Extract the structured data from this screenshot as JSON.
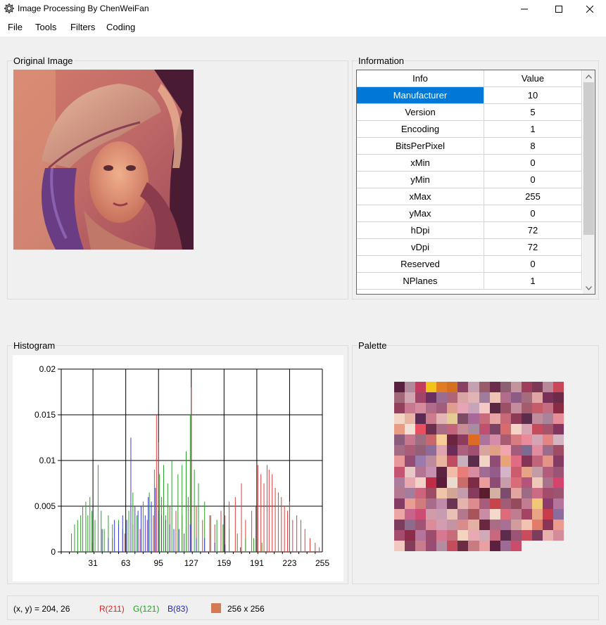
{
  "window": {
    "title": "Image Processing  By ChenWeiFan",
    "icons": {
      "app": "gear-icon",
      "minimize": "minimize-icon",
      "maximize": "maximize-icon",
      "close": "close-icon"
    }
  },
  "menu": [
    "File",
    "Tools",
    "Filters",
    "Coding"
  ],
  "original_image": {
    "group_title": "Original Image",
    "description_icon": "portrait-photo"
  },
  "information": {
    "group_title": "Information",
    "columns": [
      "Info",
      "Value"
    ],
    "rows": [
      [
        "Manufacturer",
        "10"
      ],
      [
        "Version",
        "5"
      ],
      [
        "Encoding",
        "1"
      ],
      [
        "BitsPerPixel",
        "8"
      ],
      [
        "xMin",
        "0"
      ],
      [
        "yMin",
        "0"
      ],
      [
        "xMax",
        "255"
      ],
      [
        "yMax",
        "0"
      ],
      [
        "hDpi",
        "72"
      ],
      [
        "vDpi",
        "72"
      ],
      [
        "Reserved",
        "0"
      ],
      [
        "NPlanes",
        "1"
      ]
    ],
    "selected_row": 0
  },
  "histogram": {
    "group_title": "Histogram"
  },
  "chart_data": {
    "type": "bar",
    "xlim": [
      0,
      255
    ],
    "ylim": [
      0,
      0.02
    ],
    "xticks": [
      31,
      63,
      95,
      127,
      159,
      191,
      223,
      255
    ],
    "yticks": [
      "0",
      "0.005",
      "0.01",
      "0.015",
      "0.02"
    ],
    "ytick_values": [
      0,
      0.005,
      0.01,
      0.015,
      0.02
    ],
    "grid": true,
    "series": [
      {
        "color": "#e03c3c",
        "bars": [
          [
            30,
            0.001
          ],
          [
            50,
            0.0015
          ],
          [
            62,
            0.002
          ],
          [
            70,
            0.003
          ],
          [
            77,
            0.0025
          ],
          [
            84,
            0.0035
          ],
          [
            90,
            0.004
          ],
          [
            93,
            0.015
          ],
          [
            95,
            0.012
          ],
          [
            98,
            0.006
          ],
          [
            102,
            0.004
          ],
          [
            106,
            0.005
          ],
          [
            112,
            0.0045
          ],
          [
            118,
            0.004
          ],
          [
            124,
            0.006
          ],
          [
            127,
            0.018
          ],
          [
            132,
            0.005
          ],
          [
            138,
            0.0035
          ],
          [
            145,
            0.004
          ],
          [
            150,
            0.003
          ],
          [
            156,
            0.0045
          ],
          [
            160,
            0.004
          ],
          [
            164,
            0.0055
          ],
          [
            170,
            0.006
          ],
          [
            176,
            0.0075
          ],
          [
            180,
            0.0035
          ],
          [
            186,
            0.0045
          ],
          [
            190,
            0.005
          ],
          [
            192,
            0.0095
          ],
          [
            195,
            0.0085
          ],
          [
            198,
            0.0075
          ],
          [
            201,
            0.0095
          ],
          [
            203,
            0.009
          ],
          [
            206,
            0.0085
          ],
          [
            209,
            0.007
          ],
          [
            212,
            0.0065
          ],
          [
            215,
            0.006
          ],
          [
            218,
            0.005
          ],
          [
            221,
            0.0045
          ],
          [
            223,
            0.0055
          ],
          [
            226,
            0.0035
          ],
          [
            230,
            0.004
          ],
          [
            234,
            0.0035
          ],
          [
            238,
            0.0025
          ],
          [
            243,
            0.0015
          ],
          [
            248,
            0.001
          ],
          [
            252,
            0.0005
          ]
        ]
      },
      {
        "color": "#2ca02c",
        "bars": [
          [
            10,
            0.002
          ],
          [
            13,
            0.003
          ],
          [
            16,
            0.0035
          ],
          [
            19,
            0.004
          ],
          [
            21,
            0.005
          ],
          [
            24,
            0.0055
          ],
          [
            26,
            0.004
          ],
          [
            28,
            0.006
          ],
          [
            30,
            0.0045
          ],
          [
            33,
            0.0035
          ],
          [
            36,
            0.0095
          ],
          [
            39,
            0.0045
          ],
          [
            42,
            0.0025
          ],
          [
            46,
            0.004
          ],
          [
            50,
            0.003
          ],
          [
            56,
            0.0035
          ],
          [
            60,
            0.0025
          ],
          [
            66,
            0.0045
          ],
          [
            70,
            0.0065
          ],
          [
            74,
            0.004
          ],
          [
            80,
            0.0055
          ],
          [
            86,
            0.0065
          ],
          [
            91,
            0.009
          ],
          [
            96,
            0.0085
          ],
          [
            100,
            0.0095
          ],
          [
            104,
            0.0075
          ],
          [
            108,
            0.01
          ],
          [
            114,
            0.0085
          ],
          [
            118,
            0.0095
          ],
          [
            122,
            0.011
          ],
          [
            126,
            0.015
          ],
          [
            130,
            0.009
          ],
          [
            134,
            0.0075
          ],
          [
            140,
            0.0055
          ],
          [
            146,
            0.004
          ],
          [
            152,
            0.0035
          ],
          [
            158,
            0.003
          ],
          [
            164,
            0.0025
          ],
          [
            172,
            0.002
          ],
          [
            180,
            0.0015
          ],
          [
            188,
            0.0015
          ],
          [
            196,
            0.001
          ]
        ]
      },
      {
        "color": "#3b3bd4",
        "bars": [
          [
            40,
            0.0025
          ],
          [
            46,
            0.0015
          ],
          [
            52,
            0.0035
          ],
          [
            56,
            0.003
          ],
          [
            60,
            0.004
          ],
          [
            64,
            0.0035
          ],
          [
            68,
            0.0125
          ],
          [
            72,
            0.005
          ],
          [
            75,
            0.0045
          ],
          [
            78,
            0.005
          ],
          [
            82,
            0.004
          ],
          [
            85,
            0.006
          ],
          [
            88,
            0.0055
          ],
          [
            92,
            0.007
          ],
          [
            95,
            0.0045
          ],
          [
            98,
            0.004
          ],
          [
            102,
            0.0035
          ],
          [
            106,
            0.003
          ],
          [
            110,
            0.0025
          ],
          [
            115,
            0.0025
          ],
          [
            120,
            0.002
          ],
          [
            126,
            0.003
          ],
          [
            132,
            0.0015
          ],
          [
            140,
            0.0015
          ],
          [
            150,
            0.001
          ],
          [
            160,
            0.0008
          ],
          [
            175,
            0.0005
          ]
        ]
      }
    ]
  },
  "palette": {
    "group_title": "Palette",
    "colors": [
      "#5a2040",
      "#b08a9a",
      "#c43c5c",
      "#f2c418",
      "#e07c24",
      "#d47020",
      "#8a4060",
      "#c4a0b0",
      "#9a5a6a",
      "#6c2c4c",
      "#8c6070",
      "#c4949c",
      "#a03c5c",
      "#7c3854",
      "#b88898",
      "#c84858",
      "#a06878",
      "#d0a4b0",
      "#a04468",
      "#6c3060",
      "#9a6c90",
      "#b06478",
      "#d8a4a4",
      "#e0b4b4",
      "#a07c9c",
      "#f0c4b4",
      "#b46c8c",
      "#8c5c84",
      "#a46c7c",
      "#e0a4a4",
      "#7a3058",
      "#6c2c48",
      "#94405c",
      "#c87890",
      "#d48c9c",
      "#b06c88",
      "#a25c7c",
      "#e09c8c",
      "#e8a4b4",
      "#c8a4b8",
      "#f4c8c4",
      "#5a2844",
      "#9c5068",
      "#c48c9c",
      "#a45c6c",
      "#c45c6c",
      "#c46c80",
      "#8c2c44",
      "#f4d4c4",
      "#e8b4a4",
      "#5a2c54",
      "#cc7c8c",
      "#e4b4b4",
      "#e4cc94",
      "#7c4c64",
      "#a86898",
      "#c86c7c",
      "#e8a4a4",
      "#c86878",
      "#8c3c54",
      "#5c2c4c",
      "#c08c9c",
      "#a8849c",
      "#e88c98",
      "#e89c84",
      "#f2e0d4",
      "#e85060",
      "#6a3050",
      "#a86c84",
      "#c4647c",
      "#c88c94",
      "#a88ca0",
      "#c05070",
      "#7c4464",
      "#d86c6c",
      "#f4d4c8",
      "#d8a4b4",
      "#c44c5c",
      "#a4546c",
      "#843460",
      "#8c5c7c",
      "#c8788c",
      "#a06c80",
      "#c8686c",
      "#f8cc98",
      "#6c2440",
      "#8c3c5c",
      "#dc6c24",
      "#ac7498",
      "#d48ca8",
      "#a85c70",
      "#d87c84",
      "#e88c9c",
      "#d4a4b4",
      "#e48484",
      "#d4b4c0",
      "#a46c84",
      "#ac5c78",
      "#946078",
      "#8c6c9c",
      "#e0a4b0",
      "#6a2c58",
      "#ac607c",
      "#a05070",
      "#d8a4a0",
      "#e0a084",
      "#f2a4b0",
      "#a45c7c",
      "#7c6c94",
      "#e08ca0",
      "#9c6c8c",
      "#a04c64",
      "#e89898",
      "#944c74",
      "#9a7cac",
      "#bc8c9c",
      "#e8b4a0",
      "#c04c64",
      "#c8b0bc",
      "#5c2c4c",
      "#f0d4c4",
      "#904c74",
      "#e8a478",
      "#e06c84",
      "#843454",
      "#c0647c",
      "#e49484",
      "#843c64",
      "#c45470",
      "#e8c8c4",
      "#b47494",
      "#c890b0",
      "#5c2440",
      "#f0bca8",
      "#e87c78",
      "#d88ca0",
      "#a06c94",
      "#945c88",
      "#d4b4c8",
      "#cc5c6c",
      "#e4a488",
      "#c49ca8",
      "#b45c7c",
      "#9c5474",
      "#ac7c9c",
      "#e8a8b0",
      "#f4d0c8",
      "#c02c44",
      "#5c1c3c",
      "#e8dcd0",
      "#c86c6c",
      "#7c2c44",
      "#ec9c9c",
      "#8c4c74",
      "#c89ca8",
      "#d86c78",
      "#b4547c",
      "#f0c8b8",
      "#a8748c",
      "#d4446c",
      "#b47890",
      "#a47c9c",
      "#cc647c",
      "#9c4c64",
      "#f0c4a8",
      "#d4a494",
      "#c49cac",
      "#883c5c",
      "#5c1c30",
      "#d4b0a4",
      "#7c4c6c",
      "#e4a4a0",
      "#9c6c84",
      "#cc6c84",
      "#a44c6c",
      "#9c5470",
      "#843c64",
      "#e89c94",
      "#d07c7c",
      "#aa6a8a",
      "#c08aaa",
      "#6c3454",
      "#e4b4ac",
      "#dc8c8c",
      "#a85c7c",
      "#c8444c",
      "#a45c74",
      "#944c5c",
      "#c47c94",
      "#f0c878",
      "#8c3c6c",
      "#b4749c",
      "#eca4a4",
      "#c8648c",
      "#cc4c74",
      "#d09cac",
      "#c89cb0",
      "#e8c0b4",
      "#b4788c",
      "#a8545c",
      "#c88ca4",
      "#f4d8cc",
      "#dc6c7c",
      "#c07c90",
      "#a44464",
      "#e8a484",
      "#c83c4c",
      "#8c6c9c",
      "#7c3c5c",
      "#8c6c8c",
      "#a05474",
      "#dc8c98",
      "#d49cb0",
      "#c494a4",
      "#d88c8c",
      "#e4b0a4",
      "#6a2840",
      "#ac6c84",
      "#a87094",
      "#d09c9c",
      "#f0c4b0",
      "#e07c68",
      "#8a3458",
      "#ec9c8c",
      "#a44c6c",
      "#8c2c48",
      "#b4749c",
      "#9c4c6c",
      "#d87890",
      "#c86c7c",
      "#f4d4c0",
      "#e8a8b4",
      "#d0aab8",
      "#c8687c",
      "#5c2c4c",
      "#9c5474",
      "#c84c5c",
      "#7c3c5c",
      "#e8b0ac",
      "#d48c9c",
      "#f0c8c0",
      "#843c5c",
      "#c87c8c",
      "#9c4c74",
      "#b48ca0",
      "#c44c5c",
      "#6c2c44",
      "#c87c80",
      "#e8a0a0",
      "#5c2040",
      "#9c6c94",
      "#c84c6c"
    ]
  },
  "statusbar": {
    "coords": "(x, y) = 204, 26",
    "r": "R(211)",
    "g": "G(121)",
    "b": "B(83)",
    "swatch_color": "#d37953",
    "size": "256 x 256"
  }
}
